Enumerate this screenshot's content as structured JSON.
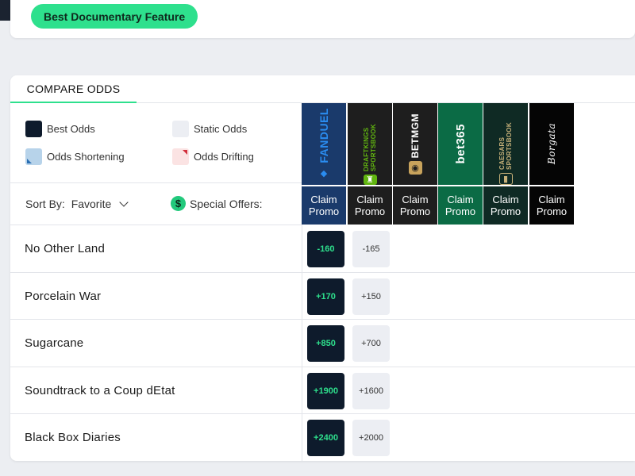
{
  "category": {
    "label": "Best Documentary Feature"
  },
  "tabs": [
    {
      "label": "COMPARE ODDS"
    }
  ],
  "legend": {
    "best": "Best Odds",
    "static": "Static Odds",
    "shortening": "Odds Shortening",
    "drifting": "Odds Drifting"
  },
  "sort": {
    "label": "Sort By:",
    "value": "Favorite"
  },
  "special_offers": {
    "label": "Special Offers:",
    "icon": "$"
  },
  "sportsbooks": [
    {
      "name": "FANDUEL",
      "color": "#1a3a6b",
      "claim": "Claim Promo"
    },
    {
      "name": "DRAFTKINGS SPORTSBOOK",
      "color": "#1e1e1e",
      "claim": "Claim Promo"
    },
    {
      "name": "BETMGM",
      "color": "#1e1e1e",
      "claim": "Claim Promo"
    },
    {
      "name": "bet365",
      "color": "#0b6b45",
      "claim": "Claim Promo"
    },
    {
      "name": "CAESARS SPORTSBOOK",
      "color": "#0f2a24",
      "claim": "Claim Promo"
    },
    {
      "name": "Borgata",
      "color": "#050505",
      "claim": "Claim Promo"
    }
  ],
  "nominees": [
    {
      "name": "No Other Land",
      "odds_best": "-160",
      "odds_static": "-165"
    },
    {
      "name": "Porcelain War",
      "odds_best": "+170",
      "odds_static": "+150"
    },
    {
      "name": "Sugarcane",
      "odds_best": "+850",
      "odds_static": "+700"
    },
    {
      "name": "Soundtrack to a Coup dEtat",
      "odds_best": "+1900",
      "odds_static": "+1600"
    },
    {
      "name": "Black Box Diaries",
      "odds_best": "+2400",
      "odds_static": "+2000"
    }
  ]
}
